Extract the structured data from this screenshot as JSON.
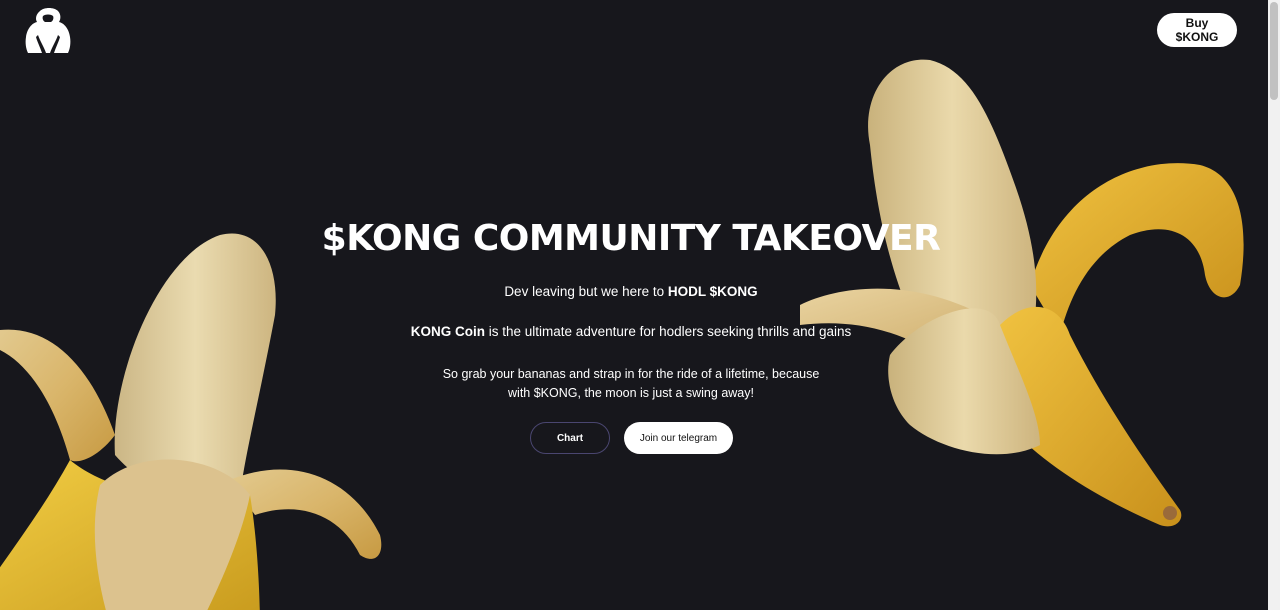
{
  "header": {
    "logo_icon": "gorilla-icon",
    "buy_label": "Buy $KONG"
  },
  "hero": {
    "title": "$KONG COMMUNITY TAKEOVER",
    "line1_prefix": "Dev leaving but we here to ",
    "line1_bold": "HODL $KONG",
    "line2_bold": "KONG Coin",
    "line2_suffix": " is the ultimate adventure for hodlers seeking thrills and gains",
    "line3_a": "So grab your bananas and strap in for the ride of a lifetime, because",
    "line3_b": "with $KONG, the moon is just a swing away!",
    "chart_label": "Chart",
    "telegram_label": "Join our telegram"
  },
  "colors": {
    "background": "#17171c",
    "banana_yellow": "#f0c53a",
    "banana_flesh": "#e6d6a6"
  }
}
